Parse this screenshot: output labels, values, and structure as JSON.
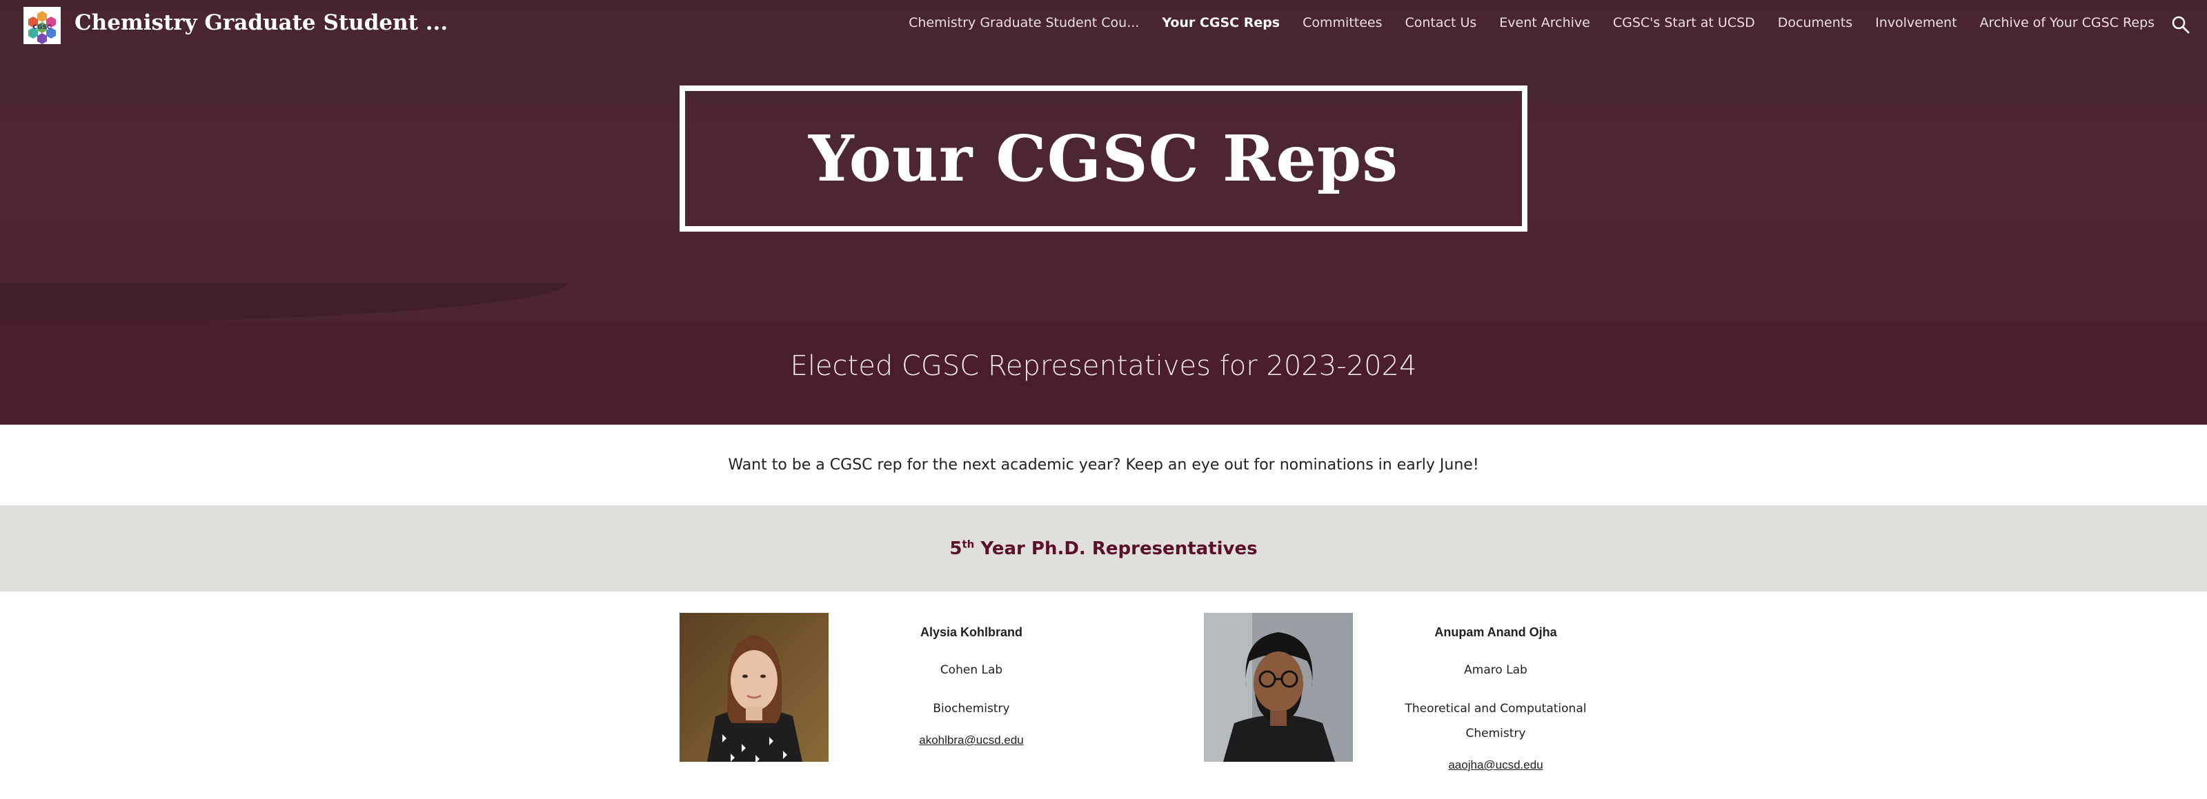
{
  "header": {
    "site_title": "Chemistry Graduate Student ...",
    "logo_icon": "cgsc-hexagon-logo-icon",
    "nav": [
      {
        "label": "Chemistry Graduate Student Cou...",
        "active": false
      },
      {
        "label": "Your CGSC Reps",
        "active": true
      },
      {
        "label": "Committees",
        "active": false
      },
      {
        "label": "Contact Us",
        "active": false
      },
      {
        "label": "Event Archive",
        "active": false
      },
      {
        "label": "CGSC's Start at UCSD",
        "active": false
      },
      {
        "label": "Documents",
        "active": false
      },
      {
        "label": "Involvement",
        "active": false
      },
      {
        "label": "Archive of Your CGSC Reps",
        "active": false
      }
    ],
    "search_icon": "search-icon"
  },
  "hero": {
    "title": "Your CGSC Reps",
    "subtitle": "Elected CGSC Representatives for 2023-2024"
  },
  "notice": "Want to be a CGSC rep for the next academic year? Keep an eye out for nominations in early June!",
  "section": {
    "title_prefix": "5",
    "title_sup": "th",
    "title_suffix": " Year Ph.D. Representatives"
  },
  "reps": [
    {
      "name": "Alysia Kohlbrand",
      "lab": "Cohen Lab",
      "field_line1": "Biochemistry",
      "field_line2": "",
      "email": "akohlbra@ucsd.edu"
    },
    {
      "name": "Anupam Anand Ojha",
      "lab": "Amaro Lab",
      "field_line1": "Theoretical and Computational",
      "field_line2": "Chemistry",
      "email": "aaojha@ucsd.edu"
    }
  ],
  "colors": {
    "hero_bg": "#4a2331",
    "section_bg": "#e1dfdb",
    "section_title": "#5b0f2b"
  }
}
